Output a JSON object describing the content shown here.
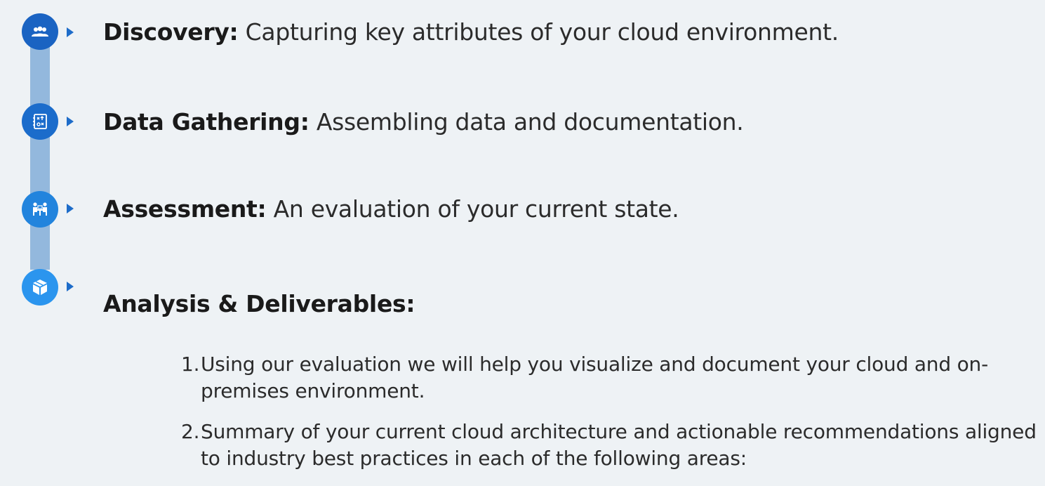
{
  "colors": {
    "rail": "#93b8dd",
    "node_1": "#1a63c2",
    "node_2": "#1b6ccb",
    "node_3": "#2284dd",
    "node_4": "#2b95ee",
    "arrow": "#1d6cc9"
  },
  "steps": [
    {
      "icon": "team-icon",
      "title": "Discovery:",
      "text": "Capturing key attributes of your cloud environment."
    },
    {
      "icon": "notebook-icon",
      "title": "Data Gathering:",
      "text": "Assembling data and documentation."
    },
    {
      "icon": "meeting-icon",
      "title": "Assessment:",
      "text": "An evaluation of your current state."
    },
    {
      "icon": "package-icon",
      "title": "Analysis & Deliverables:",
      "text": ""
    }
  ],
  "deliverables": [
    {
      "number": "1.",
      "text": "Using our evaluation we will help you visualize and document your cloud and on-premises environment."
    },
    {
      "number": "2.",
      "text": "Summary of your current cloud architecture and actionable recommendations aligned to industry best practices in each of the following areas:"
    }
  ]
}
